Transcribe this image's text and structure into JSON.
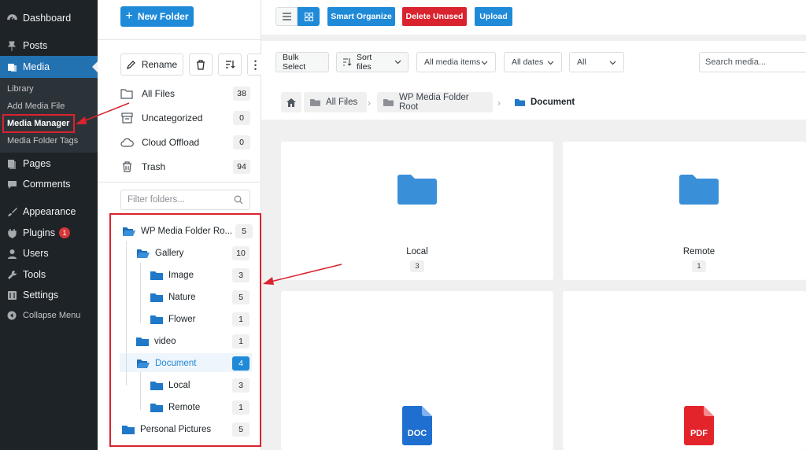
{
  "sidebar": {
    "items": [
      {
        "label": "Dashboard",
        "icon": "dashboard-icon"
      },
      {
        "label": "Posts",
        "icon": "pin-icon"
      },
      {
        "label": "Media",
        "icon": "media-icon"
      },
      {
        "label": "Pages",
        "icon": "page-icon"
      },
      {
        "label": "Comments",
        "icon": "comment-icon"
      },
      {
        "label": "Appearance",
        "icon": "brush-icon"
      },
      {
        "label": "Plugins",
        "icon": "plug-icon",
        "badge": "1"
      },
      {
        "label": "Users",
        "icon": "user-icon"
      },
      {
        "label": "Tools",
        "icon": "wrench-icon"
      },
      {
        "label": "Settings",
        "icon": "settings-icon"
      },
      {
        "label": "Collapse Menu",
        "icon": "collapse-icon"
      }
    ],
    "submenu": [
      "Library",
      "Add Media File",
      "Media Manager",
      "Media Folder Tags"
    ]
  },
  "folder_panel": {
    "new_folder": "New Folder",
    "rename": "Rename",
    "standard_folders": [
      {
        "label": "All Files",
        "count": "38"
      },
      {
        "label": "Uncategorized",
        "count": "0"
      },
      {
        "label": "Cloud Offload",
        "count": "0"
      },
      {
        "label": "Trash",
        "count": "94"
      }
    ],
    "filter_placeholder": "Filter folders...",
    "tree": [
      {
        "label": "WP Media Folder Ro...",
        "count": "5"
      },
      {
        "label": "Gallery",
        "count": "10"
      },
      {
        "label": "Image",
        "count": "3"
      },
      {
        "label": "Nature",
        "count": "5"
      },
      {
        "label": "Flower",
        "count": "1"
      },
      {
        "label": "video",
        "count": "1"
      },
      {
        "label": "Document",
        "count": "4"
      },
      {
        "label": "Local",
        "count": "3"
      },
      {
        "label": "Remote",
        "count": "1"
      },
      {
        "label": "Personal Pictures",
        "count": "5"
      }
    ]
  },
  "toolbar": {
    "smart_organize": "Smart Organize",
    "delete_unused": "Delete Unused",
    "upload": "Upload"
  },
  "filters": {
    "bulk_select": "Bulk Select",
    "sort_files": "Sort files",
    "media_items": "All media items",
    "dates": "All dates",
    "all": "All",
    "search_placeholder": "Search media..."
  },
  "breadcrumb": [
    "All Files",
    "WP Media Folder Root",
    "Document"
  ],
  "cards": [
    {
      "name": "Local",
      "count": "3"
    },
    {
      "name": "Remote",
      "count": "1"
    },
    {
      "type_label": "DOC"
    },
    {
      "type_label": "PDF"
    }
  ],
  "colors": {
    "accent": "#1f8ad8",
    "danger": "#d9232e",
    "admin_bar": "#1d2327",
    "active_menu": "#2271b1",
    "doc": "#1f6fd1",
    "pdf": "#e3242b"
  }
}
